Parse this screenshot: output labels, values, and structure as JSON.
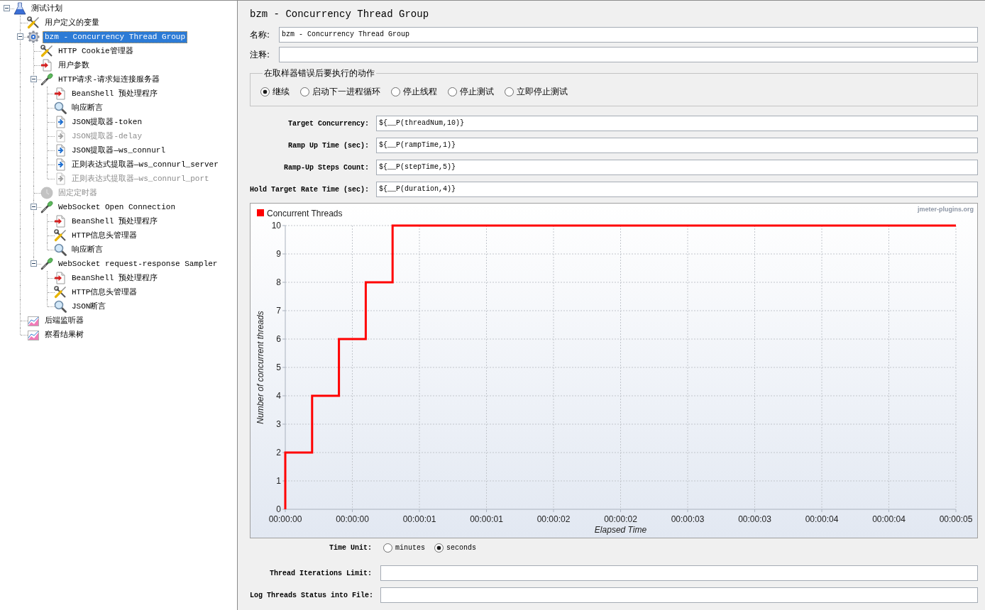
{
  "tree": {
    "items": [
      {
        "label": "测试计划",
        "kind": "plan",
        "selected": false,
        "disabled": false,
        "expanded": true,
        "children": [
          {
            "label": "用户定义的变量",
            "kind": "config",
            "selected": false,
            "disabled": false
          },
          {
            "label": "bzm - Concurrency Thread Group",
            "kind": "thread_group",
            "selected": true,
            "disabled": false,
            "expanded": true,
            "children": [
              {
                "label": "HTTP Cookie管理器",
                "kind": "config",
                "selected": false,
                "disabled": false
              },
              {
                "label": "用户参数",
                "kind": "preprocessor",
                "selected": false,
                "disabled": false
              },
              {
                "label": "HTTP请求-请求短连接服务器",
                "kind": "sampler",
                "selected": false,
                "disabled": false,
                "expanded": true,
                "children": [
                  {
                    "label": "BeanShell 预处理程序",
                    "kind": "preprocessor",
                    "selected": false,
                    "disabled": false
                  },
                  {
                    "label": "响应断言",
                    "kind": "assertion",
                    "selected": false,
                    "disabled": false
                  },
                  {
                    "label": "JSON提取器-token",
                    "kind": "postprocessor",
                    "selected": false,
                    "disabled": false
                  },
                  {
                    "label": "JSON提取器-delay",
                    "kind": "postprocessor",
                    "selected": false,
                    "disabled": true
                  },
                  {
                    "label": "JSON提取器—ws_connurl",
                    "kind": "postprocessor",
                    "selected": false,
                    "disabled": false
                  },
                  {
                    "label": "正则表达式提取器—ws_connurl_server",
                    "kind": "postprocessor",
                    "selected": false,
                    "disabled": false
                  },
                  {
                    "label": "正则表达式提取器—ws_connurl_port",
                    "kind": "postprocessor",
                    "selected": false,
                    "disabled": true
                  }
                ]
              },
              {
                "label": "固定定时器",
                "kind": "timer",
                "selected": false,
                "disabled": true
              },
              {
                "label": "WebSocket Open Connection",
                "kind": "sampler",
                "selected": false,
                "disabled": false,
                "expanded": true,
                "children": [
                  {
                    "label": "BeanShell 预处理程序",
                    "kind": "preprocessor",
                    "selected": false,
                    "disabled": false
                  },
                  {
                    "label": "HTTP信息头管理器",
                    "kind": "config",
                    "selected": false,
                    "disabled": false
                  },
                  {
                    "label": "响应断言",
                    "kind": "assertion",
                    "selected": false,
                    "disabled": false
                  }
                ]
              },
              {
                "label": "WebSocket request-response Sampler",
                "kind": "sampler",
                "selected": false,
                "disabled": false,
                "expanded": true,
                "children": [
                  {
                    "label": "BeanShell 预处理程序",
                    "kind": "preprocessor",
                    "selected": false,
                    "disabled": false
                  },
                  {
                    "label": "HTTP信息头管理器",
                    "kind": "config",
                    "selected": false,
                    "disabled": false
                  },
                  {
                    "label": "JSON断言",
                    "kind": "assertion",
                    "selected": false,
                    "disabled": false
                  }
                ]
              }
            ]
          },
          {
            "label": "后端监听器",
            "kind": "listener",
            "selected": false,
            "disabled": false
          },
          {
            "label": "察看结果树",
            "kind": "listener",
            "selected": false,
            "disabled": false
          }
        ]
      }
    ]
  },
  "form": {
    "title": "bzm - Concurrency Thread Group",
    "fields": [
      {
        "label": "名称:",
        "value": "bzm - Concurrency Thread Group"
      },
      {
        "label": "注释:"
      }
    ],
    "on_error": {
      "legend": "在取样器错误后要执行的动作",
      "options": [
        {
          "label": "继续",
          "selected": true
        },
        {
          "label": "启动下一进程循环",
          "selected": false
        },
        {
          "label": "停止线程",
          "selected": false
        },
        {
          "label": "停止测试",
          "selected": false
        },
        {
          "label": "立即停止测试",
          "selected": false
        }
      ]
    },
    "params": [
      {
        "label": "Target Concurrency:",
        "value": "${__P(threadNum,10)}"
      },
      {
        "label": "Ramp Up Time (sec):",
        "value": "${__P(rampTime,1)}"
      },
      {
        "label": "Ramp-Up Steps Count:",
        "value": "${__P(stepTime,5)}"
      },
      {
        "label": "Hold Target Rate Time (sec):",
        "value": "${__P(duration,4)}"
      }
    ],
    "chart": {
      "credit": "jmeter-plugins.org",
      "chart_data": {
        "type": "line",
        "grid": true,
        "xlabel": "Elapsed Time",
        "ylabel": "Number of concurrent threads",
        "x": [
          0,
          0,
          0.2,
          0.2,
          0.4,
          0.4,
          0.6,
          0.6,
          0.8,
          0.8,
          5
        ],
        "series": [
          {
            "name": "Concurrent Threads",
            "color": "#ff0000",
            "values": [
              0,
              2,
              2,
              4,
              4,
              6,
              6,
              8,
              8,
              10,
              10
            ]
          }
        ],
        "xlim": [
          0,
          5
        ],
        "ylim": [
          0,
          10
        ],
        "xticks": [
          {
            "value": 0,
            "label": "00:00:00"
          },
          {
            "value": 0.5,
            "label": "00:00:00"
          },
          {
            "value": 1,
            "label": "00:00:01"
          },
          {
            "value": 1.5,
            "label": "00:00:01"
          },
          {
            "value": 2,
            "label": "00:00:02"
          },
          {
            "value": 2.5,
            "label": "00:00:02"
          },
          {
            "value": 3,
            "label": "00:00:03"
          },
          {
            "value": 3.5,
            "label": "00:00:03"
          },
          {
            "value": 4,
            "label": "00:00:04"
          },
          {
            "value": 4.5,
            "label": "00:00:04"
          },
          {
            "value": 5,
            "label": "00:00:05"
          }
        ],
        "yticks": [
          0,
          1,
          2,
          3,
          4,
          5,
          6,
          7,
          8,
          9,
          10
        ]
      }
    },
    "time_unit": {
      "label": "Time Unit:",
      "options": [
        {
          "label": "minutes",
          "selected": false
        },
        {
          "label": "seconds",
          "selected": true
        }
      ]
    },
    "extra_fields": [
      {
        "label": "Thread Iterations Limit:"
      },
      {
        "label": "Log Threads Status into File:"
      }
    ]
  }
}
